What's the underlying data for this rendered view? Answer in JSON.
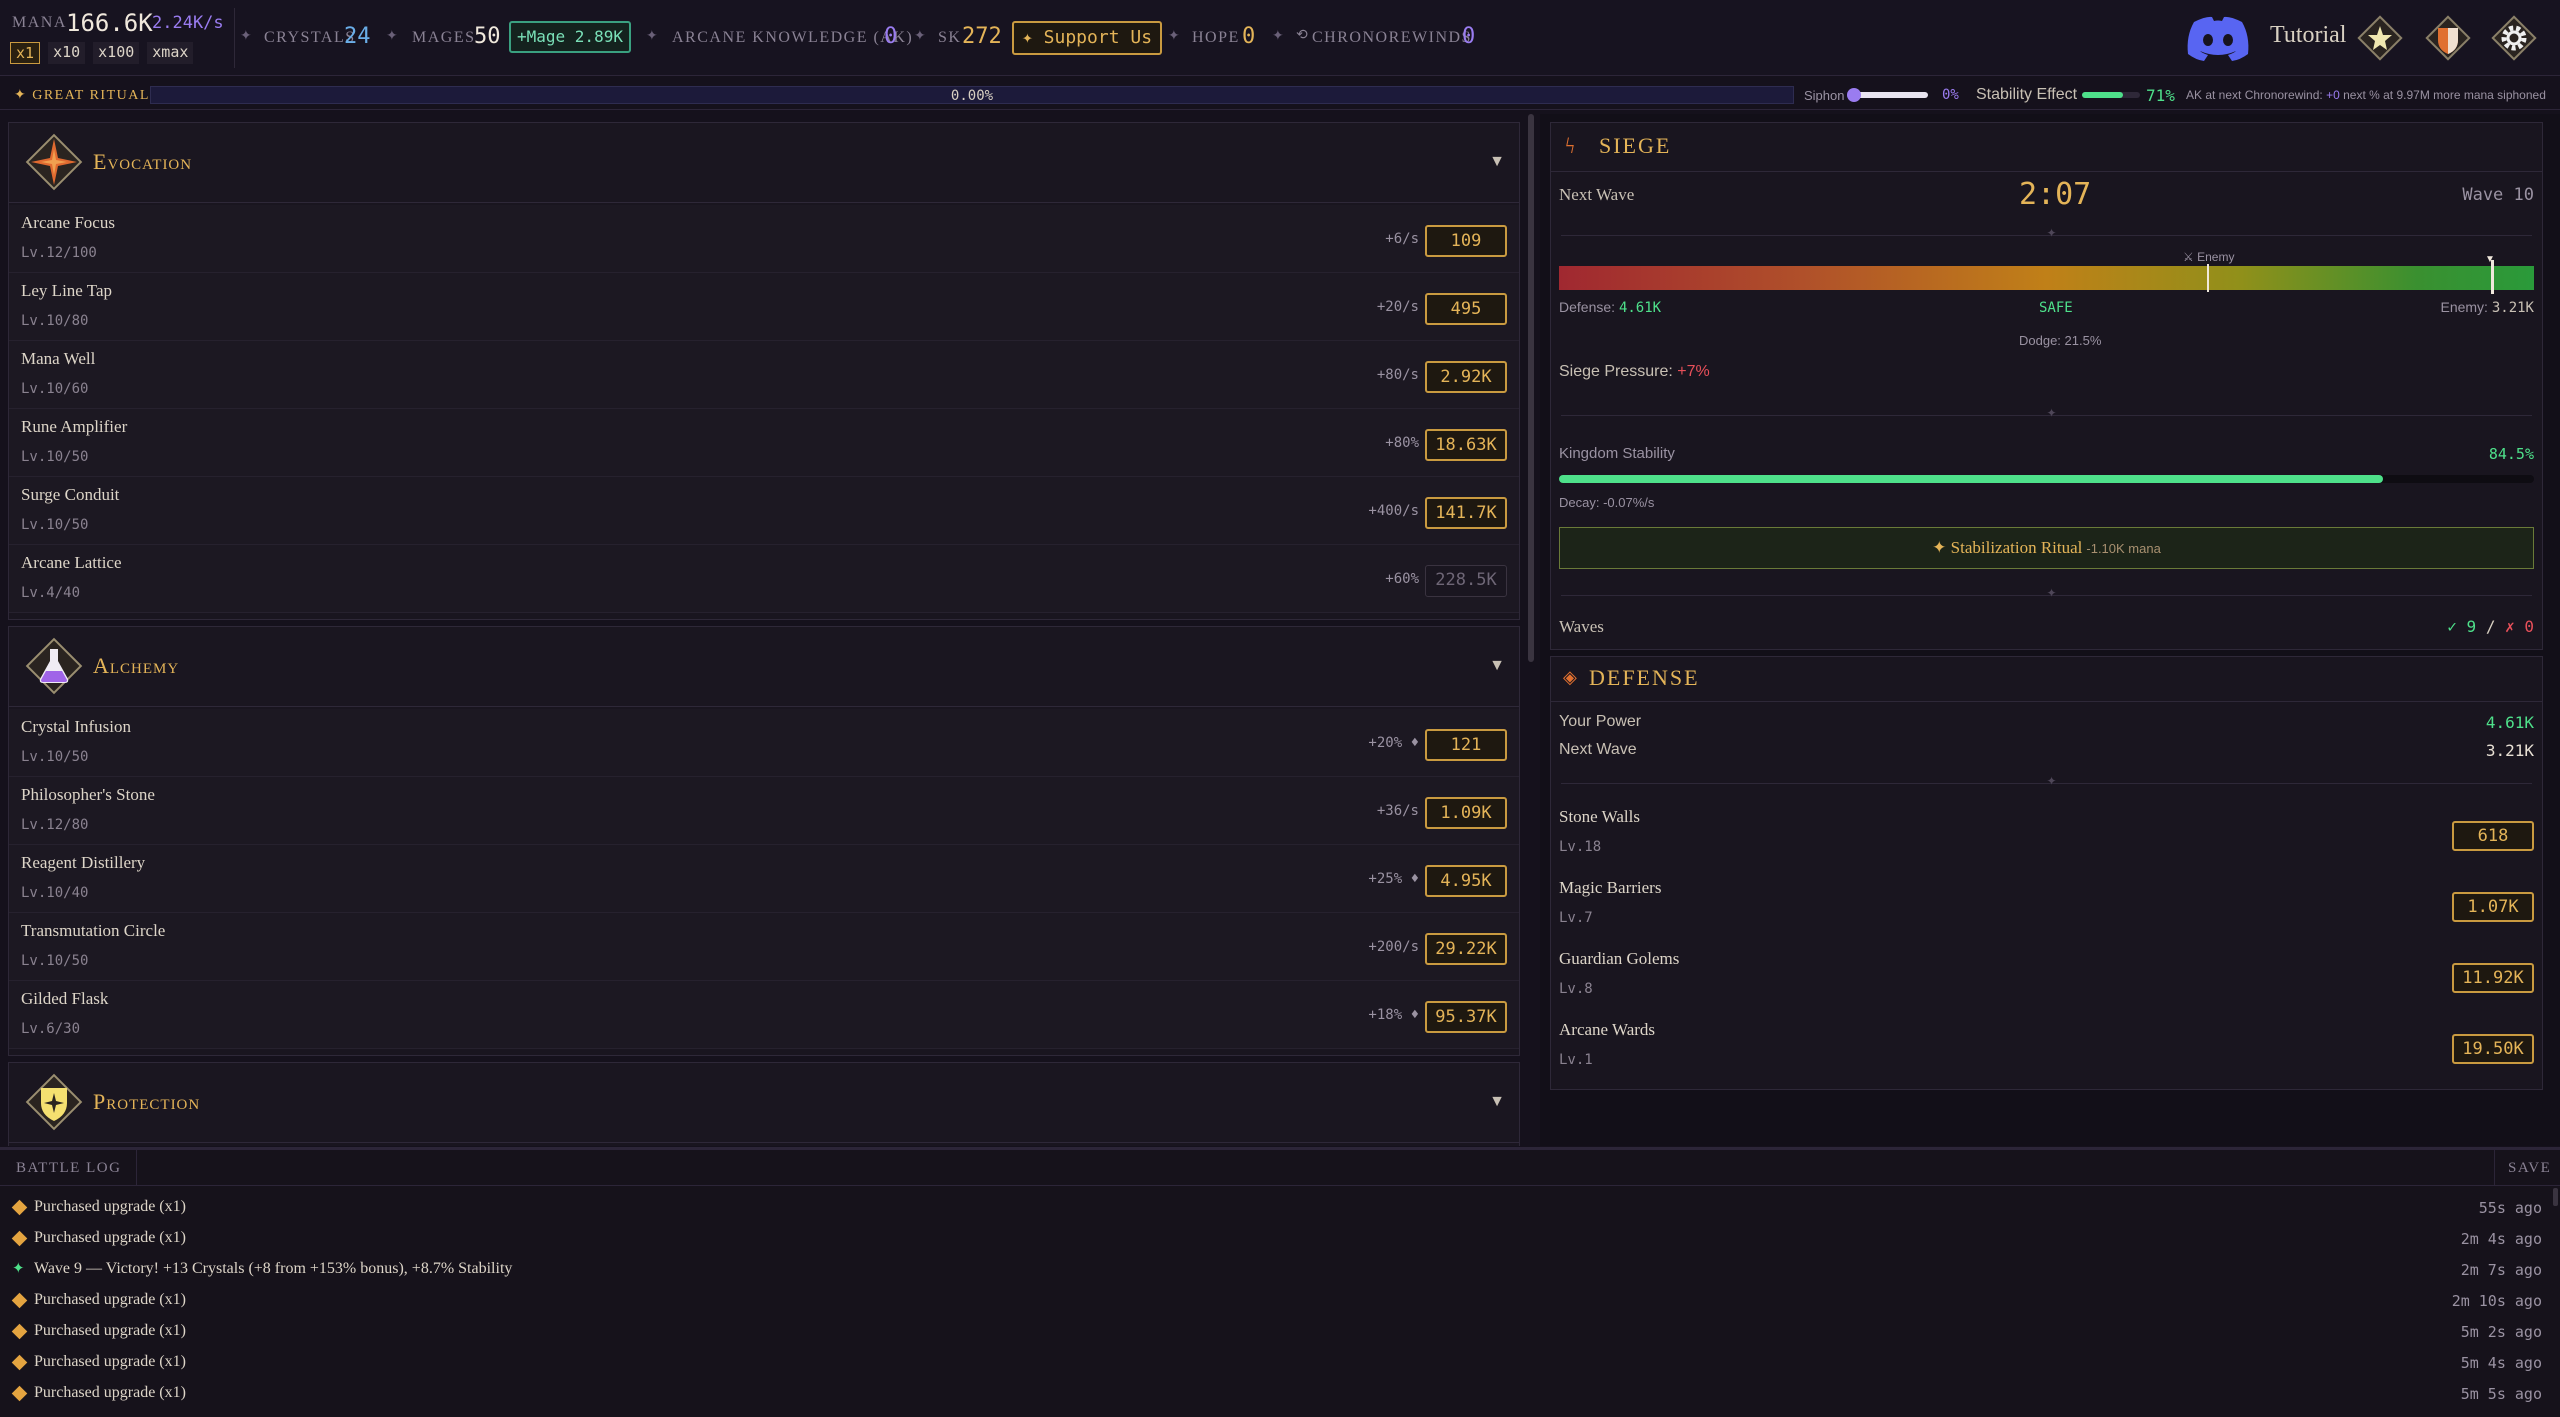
{
  "topbar": {
    "mana_label": "MANA",
    "mana_value": "166.6K",
    "mana_rate": "2.24K/s",
    "multipliers": [
      "x1",
      "x10",
      "x100",
      "xmax"
    ],
    "crystals_label": "CRYSTALS",
    "crystals_value": "24",
    "mages_label": "MAGES",
    "mages_value": "50",
    "mage_button": "+Mage 2.89K",
    "ak_label": "ARCANE KNOWLEDGE (AK)",
    "ak_value": "0",
    "sk_label": "SK",
    "sk_value": "272",
    "support_button": "✦ Support Us",
    "hope_label": "HOPE",
    "hope_value": "0",
    "chrono_label": "CHRONOREWINDS",
    "chrono_value": "0",
    "tutorial_label": "Tutorial"
  },
  "ritual": {
    "label": "✦ GREAT RITUAL",
    "progress_text": "0.00%",
    "progress": 0,
    "siphon_label": "Siphon",
    "siphon_value": "0%",
    "stability_label": "Stability Effect",
    "stability_value": "71%",
    "stability_fill": 0.71,
    "ak_next_prefix": "AK at next Chronorewind: ",
    "ak_next_value": "+0",
    "ak_next_suffix": " next % at 9.97M more mana siphoned"
  },
  "evocation": {
    "title": "Evocation",
    "items": [
      {
        "name": "Arcane Focus",
        "level": "Lv.12/100",
        "rate": "+6/s",
        "cost": "109",
        "enabled": true
      },
      {
        "name": "Ley Line Tap",
        "level": "Lv.10/80",
        "rate": "+20/s",
        "cost": "495",
        "enabled": true
      },
      {
        "name": "Mana Well",
        "level": "Lv.10/60",
        "rate": "+80/s",
        "cost": "2.92K",
        "enabled": true
      },
      {
        "name": "Rune Amplifier",
        "level": "Lv.10/50",
        "rate": "+80%",
        "cost": "18.63K",
        "enabled": true
      },
      {
        "name": "Surge Conduit",
        "level": "Lv.10/50",
        "rate": "+400/s",
        "cost": "141.7K",
        "enabled": true
      },
      {
        "name": "Arcane Lattice",
        "level": "Lv.4/40",
        "rate": "+60%",
        "cost": "228.5K",
        "enabled": false
      }
    ]
  },
  "alchemy": {
    "title": "Alchemy",
    "items": [
      {
        "name": "Crystal Infusion",
        "level": "Lv.10/50",
        "rate": "+20% ♦",
        "cost": "121",
        "enabled": true
      },
      {
        "name": "Philosopher's Stone",
        "level": "Lv.12/80",
        "rate": "+36/s",
        "cost": "1.09K",
        "enabled": true
      },
      {
        "name": "Reagent Distillery",
        "level": "Lv.10/40",
        "rate": "+25% ♦",
        "cost": "4.95K",
        "enabled": true
      },
      {
        "name": "Transmutation Circle",
        "level": "Lv.10/50",
        "rate": "+200/s",
        "cost": "29.22K",
        "enabled": true
      },
      {
        "name": "Gilded Flask",
        "level": "Lv.6/30",
        "rate": "+18% ♦",
        "cost": "95.37K",
        "enabled": true
      }
    ]
  },
  "protection": {
    "title": "Protection"
  },
  "siege": {
    "title": "SIEGE",
    "next_wave_label": "Next Wave",
    "timer": "2:07",
    "wave_label": "Wave 10",
    "enemy_marker": "⚔ Enemy",
    "defense_label": "Defense:",
    "defense_value": "4.61K",
    "status": "SAFE",
    "enemy_label": "Enemy:",
    "enemy_value": "3.21K",
    "dodge": "Dodge: 21.5%",
    "pressure_label": "Siege Pressure:",
    "pressure_value": "+7%",
    "kingdom_label": "Kingdom Stability",
    "kingdom_value": "84.5%",
    "kingdom_fill": 0.845,
    "decay": "Decay: -0.07%/s",
    "ritual_button": "✦ Stabilization Ritual",
    "ritual_cost": "-1.10K mana",
    "waves_label": "Waves",
    "wins": "✓ 9",
    "slash": "/",
    "losses": "✗ 0"
  },
  "defense": {
    "title": "DEFENSE",
    "power_label": "Your Power",
    "power_value": "4.61K",
    "next_label": "Next Wave",
    "next_value": "3.21K",
    "items": [
      {
        "name": "Stone Walls",
        "level": "Lv.18",
        "cost": "618"
      },
      {
        "name": "Magic Barriers",
        "level": "Lv.7",
        "cost": "1.07K"
      },
      {
        "name": "Guardian Golems",
        "level": "Lv.8",
        "cost": "11.92K"
      },
      {
        "name": "Arcane Wards",
        "level": "Lv.1",
        "cost": "19.50K"
      }
    ]
  },
  "log": {
    "tab": "BATTLE LOG",
    "save": "SAVE",
    "entries": [
      {
        "text": "Purchased upgrade (x1)",
        "time": "55s ago",
        "kind": "purchase"
      },
      {
        "text": "Purchased upgrade (x1)",
        "time": "2m 4s ago",
        "kind": "purchase"
      },
      {
        "text": "Wave 9 — Victory! +13 Crystals (+8 from +153% bonus), +8.7% Stability",
        "time": "2m 7s ago",
        "kind": "victory"
      },
      {
        "text": "Purchased upgrade (x1)",
        "time": "2m 10s ago",
        "kind": "purchase"
      },
      {
        "text": "Purchased upgrade (x1)",
        "time": "5m 2s ago",
        "kind": "purchase"
      },
      {
        "text": "Purchased upgrade (x1)",
        "time": "5m 4s ago",
        "kind": "purchase"
      },
      {
        "text": "Purchased upgrade (x1)",
        "time": "5m 5s ago",
        "kind": "purchase"
      }
    ]
  },
  "colors": {
    "accent": "#e4b458",
    "mana": "#9a7cf0",
    "crystal": "#6aaee8",
    "good": "#4ee08a",
    "bad": "#e8505a"
  }
}
